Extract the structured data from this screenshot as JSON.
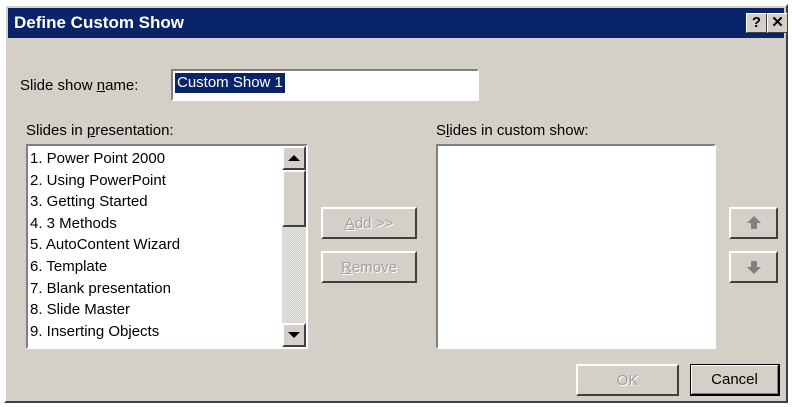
{
  "dialog": {
    "title": "Define Custom Show",
    "help_button": "?",
    "close_button": "✕"
  },
  "name": {
    "label_pre": "Slide show ",
    "label_key": "n",
    "label_post": "ame:",
    "value": "Custom Show 1"
  },
  "left_list": {
    "label_pre": "Slides in ",
    "label_key": "p",
    "label_post": "resentation:",
    "items": [
      "1. Power Point 2000",
      "2. Using PowerPoint",
      "3. Getting Started",
      "4. 3 Methods",
      "5. AutoContent Wizard",
      "6. Template",
      "7. Blank presentation",
      "8. Slide Master",
      "9. Inserting Objects"
    ]
  },
  "right_list": {
    "label_pre": "S",
    "label_key": "l",
    "label_post": "ides in custom show:",
    "items": []
  },
  "buttons": {
    "add_key": "A",
    "add_rest": "dd >>",
    "remove_key": "R",
    "remove_rest": "emove",
    "ok": "OK",
    "cancel": "Cancel"
  },
  "icons": {
    "move_up": "up-arrow",
    "move_down": "down-arrow"
  }
}
